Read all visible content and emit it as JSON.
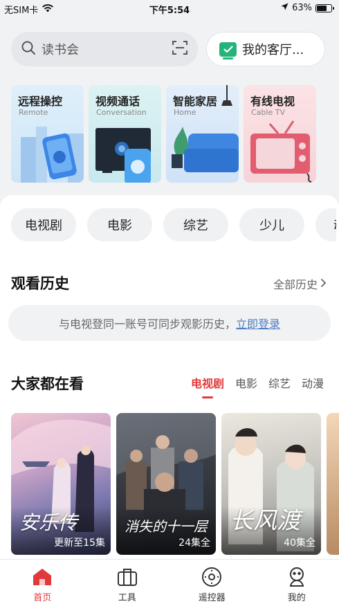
{
  "status_bar": {
    "carrier": "无SIM卡",
    "time": "下午5:54",
    "battery": "63%"
  },
  "search": {
    "placeholder": "读书会"
  },
  "living_room": {
    "label": "我的客厅..."
  },
  "feature_cards": [
    {
      "title": "远程操控",
      "subtitle": "Remote"
    },
    {
      "title": "视频通话",
      "subtitle": "Conversation"
    },
    {
      "title": "智能家居",
      "subtitle": "Home"
    },
    {
      "title": "有线电视",
      "subtitle": "Cable TV"
    }
  ],
  "categories": [
    "电视剧",
    "电影",
    "综艺",
    "少儿",
    "动"
  ],
  "history": {
    "title": "观看历史",
    "all_label": "全部历史",
    "prompt": "与电视登同一账号可同步观影历史，",
    "login_link": "立即登录"
  },
  "popular": {
    "title": "大家都在看",
    "tabs": [
      "电视剧",
      "电影",
      "综艺",
      "动漫"
    ],
    "active_tab": 0,
    "posters": [
      {
        "title": "安乐传",
        "badge": "更新至15集"
      },
      {
        "title": "消失的十一层",
        "badge": "24集全"
      },
      {
        "title": "长风渡",
        "badge": "40集全"
      }
    ]
  },
  "bottom_nav": [
    {
      "label": "首页",
      "icon": "home-icon",
      "active": true
    },
    {
      "label": "工具",
      "icon": "toolbox-icon",
      "active": false
    },
    {
      "label": "遥控器",
      "icon": "remote-icon",
      "active": false
    },
    {
      "label": "我的",
      "icon": "profile-icon",
      "active": false
    }
  ],
  "colors": {
    "accent": "#e2393b",
    "link": "#4a7dc0",
    "tv_chip": "#25b37a"
  }
}
